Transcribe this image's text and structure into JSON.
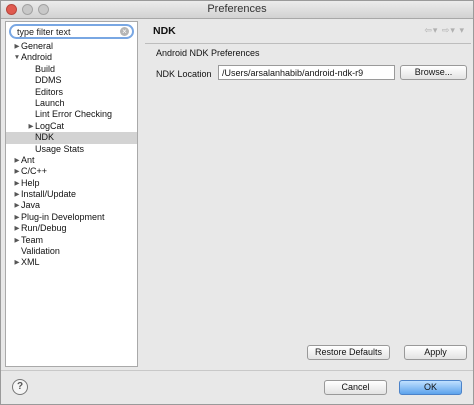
{
  "window": {
    "title": "Preferences"
  },
  "filter": {
    "placeholder": "type filter text",
    "clear_icon": "clear-icon"
  },
  "tree": [
    {
      "label": "General",
      "level": 0,
      "expander": "collapsed"
    },
    {
      "label": "Android",
      "level": 0,
      "expander": "expanded"
    },
    {
      "label": "Build",
      "level": 1,
      "expander": "none"
    },
    {
      "label": "DDMS",
      "level": 1,
      "expander": "none"
    },
    {
      "label": "Editors",
      "level": 1,
      "expander": "none"
    },
    {
      "label": "Launch",
      "level": 1,
      "expander": "none"
    },
    {
      "label": "Lint Error Checking",
      "level": 1,
      "expander": "none"
    },
    {
      "label": "LogCat",
      "level": 1,
      "expander": "collapsed"
    },
    {
      "label": "NDK",
      "level": 1,
      "expander": "none",
      "selected": true
    },
    {
      "label": "Usage Stats",
      "level": 1,
      "expander": "none"
    },
    {
      "label": "Ant",
      "level": 0,
      "expander": "collapsed"
    },
    {
      "label": "C/C++",
      "level": 0,
      "expander": "collapsed"
    },
    {
      "label": "Help",
      "level": 0,
      "expander": "collapsed"
    },
    {
      "label": "Install/Update",
      "level": 0,
      "expander": "collapsed"
    },
    {
      "label": "Java",
      "level": 0,
      "expander": "collapsed"
    },
    {
      "label": "Plug-in Development",
      "level": 0,
      "expander": "collapsed"
    },
    {
      "label": "Run/Debug",
      "level": 0,
      "expander": "collapsed"
    },
    {
      "label": "Team",
      "level": 0,
      "expander": "collapsed"
    },
    {
      "label": "Validation",
      "level": 0,
      "expander": "none"
    },
    {
      "label": "XML",
      "level": 0,
      "expander": "collapsed"
    }
  ],
  "page": {
    "title": "NDK",
    "section": "Android NDK Preferences",
    "ndk_location_label": "NDK Location",
    "ndk_location_value": "/Users/arsalanhabib/android-ndk-r9",
    "browse_label": "Browse...",
    "restore_label": "Restore Defaults",
    "apply_label": "Apply"
  },
  "footer": {
    "help_label": "?",
    "cancel_label": "Cancel",
    "ok_label": "OK"
  }
}
